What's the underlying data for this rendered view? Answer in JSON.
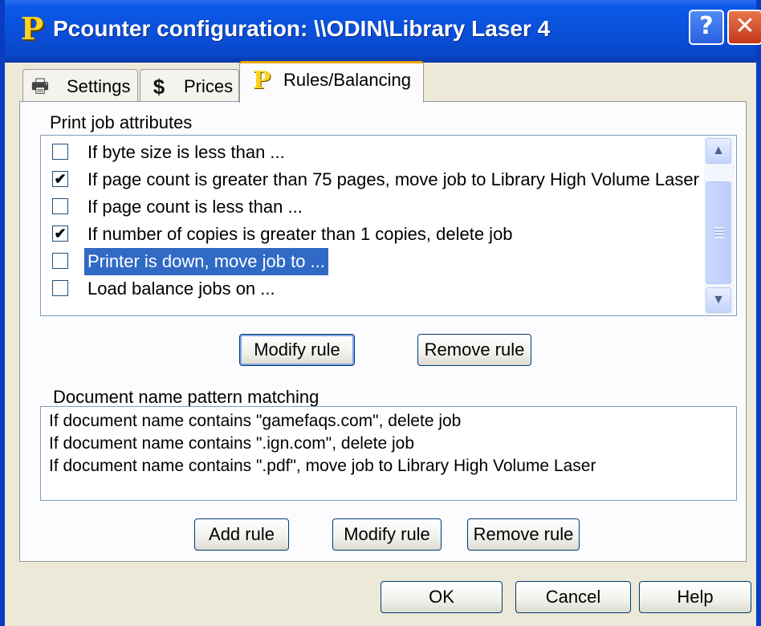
{
  "window": {
    "logo_letter": "P",
    "title": "Pcounter configuration: \\\\ODIN\\Library Laser 4",
    "help_glyph": "?",
    "close_glyph": "✕"
  },
  "tabs": [
    {
      "label": "Settings",
      "icon": "printer-icon",
      "glyph": "🖶"
    },
    {
      "label": "Prices",
      "icon": "dollar-icon",
      "glyph": "$"
    },
    {
      "label": "Rules/Balancing",
      "icon": "pcounter-logo-icon",
      "glyph": "P",
      "active": true
    }
  ],
  "print_job": {
    "label": "Print job attributes",
    "rules": [
      {
        "text": "If byte size is less than ...",
        "checked": false,
        "check_glyph": ""
      },
      {
        "text": "If page count is greater than 75 pages, move job to Library High Volume Laser",
        "checked": true,
        "check_glyph": "✔"
      },
      {
        "text": "If page count is less than ...",
        "checked": false,
        "check_glyph": ""
      },
      {
        "text": "If number of copies is greater than 1 copies, delete job",
        "checked": true,
        "check_glyph": "✔"
      },
      {
        "text": "Printer is down, move job to ...",
        "checked": false,
        "check_glyph": "",
        "selected": true
      },
      {
        "text": "Load balance jobs on ...",
        "checked": false,
        "check_glyph": ""
      }
    ],
    "modify_label": "Modify rule",
    "remove_label": "Remove rule"
  },
  "scrollbar": {
    "up_glyph": "▲",
    "down_glyph": "▼"
  },
  "doc_pattern": {
    "label": "Document name pattern matching",
    "rules": [
      "If document name contains \"gamefaqs.com\", delete job",
      "If document name contains \".ign.com\", delete job",
      "If document name contains \".pdf\", move job to Library High Volume Laser"
    ],
    "add_label": "Add rule",
    "modify_label": "Modify rule",
    "remove_label": "Remove rule"
  },
  "footer": {
    "ok_label": "OK",
    "cancel_label": "Cancel",
    "help_label": "Help"
  },
  "colors": {
    "titlebar": "#0a4fd8",
    "selection": "#316ac5",
    "active_tab_accent": "#e8a400",
    "dialog_bg": "#ece9d8"
  }
}
